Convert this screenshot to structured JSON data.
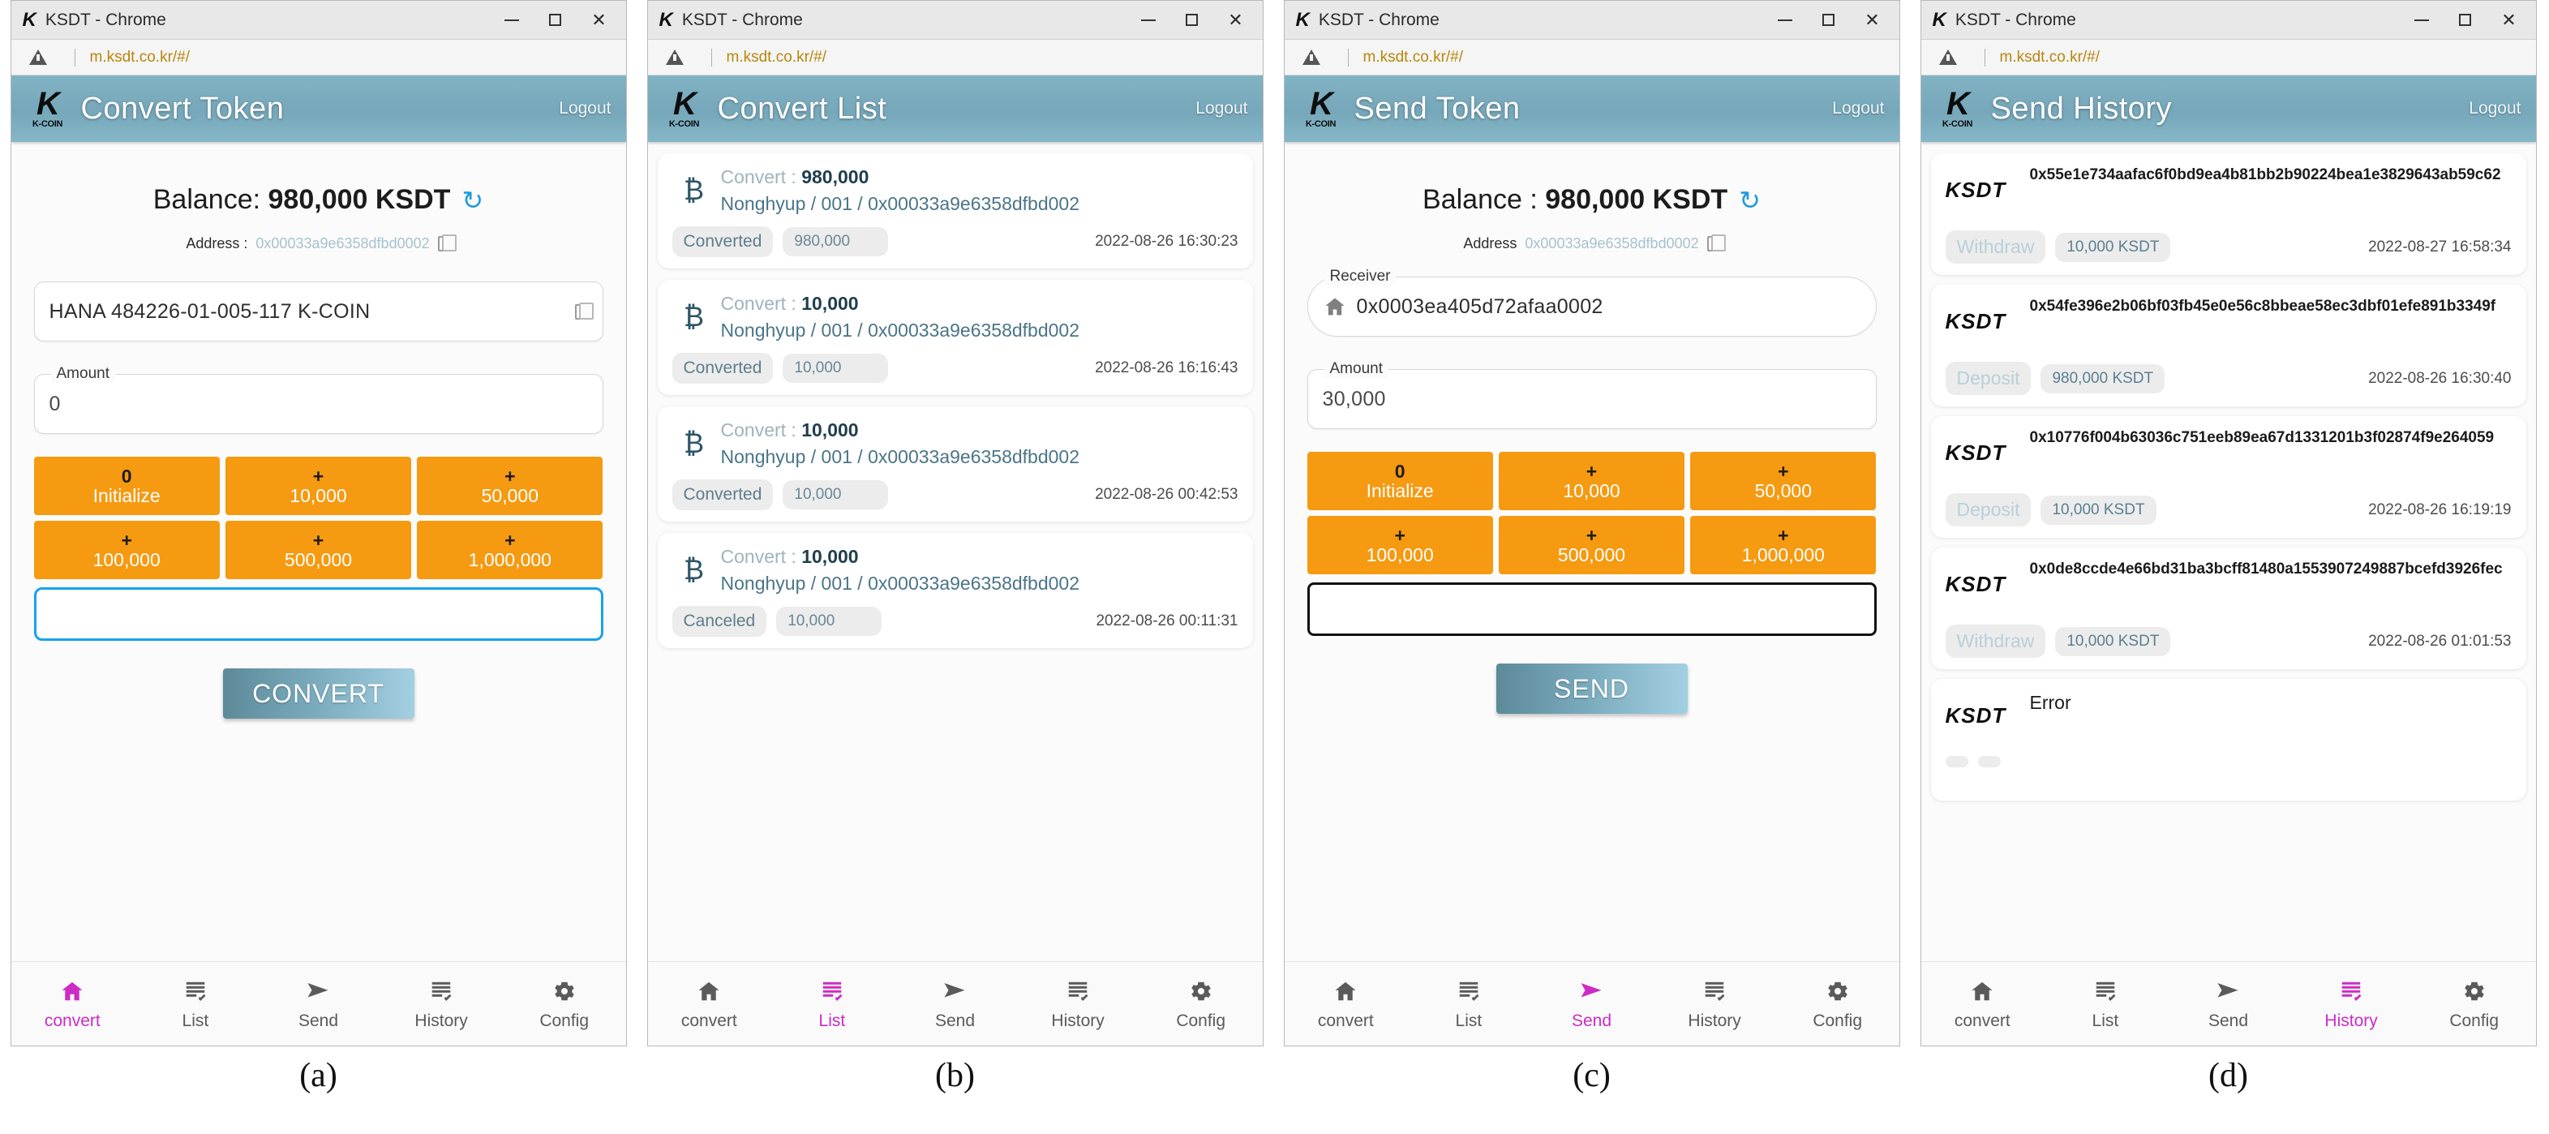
{
  "window": {
    "logo_mark": "K",
    "title": "KSDT  - Chrome",
    "url": "m.ksdt.co.kr/#/",
    "minimize_label": "–",
    "maximize_label": "☐",
    "close_label": "✕",
    "security_icon": "warning-triangle-icon"
  },
  "brand": {
    "logo_mark": "K",
    "logo_sub": "K-COIN",
    "token_logo": "KSDT"
  },
  "nav": {
    "items": [
      {
        "label": "convert",
        "icon": "home-icon"
      },
      {
        "label": "List",
        "icon": "list-check-icon"
      },
      {
        "label": "Send",
        "icon": "send-paper-plane-icon"
      },
      {
        "label": "History",
        "icon": "list-check-icon"
      },
      {
        "label": "Config",
        "icon": "gear-icon"
      }
    ]
  },
  "colors": {
    "header_teal": "#76a7ba",
    "accent_orange": "#f59a11",
    "active_magenta": "#cc2cc6",
    "focus_blue": "#16a2f0",
    "refresh_blue": "#1e9bdf",
    "url_amber": "#b8860b"
  },
  "quick_buttons": [
    {
      "top": "0",
      "bottom": "Initialize"
    },
    {
      "top": "+",
      "bottom": "10,000"
    },
    {
      "top": "+",
      "bottom": "50,000"
    },
    {
      "top": "+",
      "bottom": "100,000"
    },
    {
      "top": "+",
      "bottom": "500,000"
    },
    {
      "top": "+",
      "bottom": "1,000,000"
    }
  ],
  "panel_a": {
    "caption": "(a)",
    "header_title": "Convert Token",
    "logout_label": "Logout",
    "balance_prefix": "Balance: ",
    "balance_value": "980,000 KSDT",
    "refresh_icon": "refresh-icon",
    "address_label": "Address :",
    "address_value": "0x00033a9e6358dfbd0002",
    "copy_icon": "copy-icon",
    "account_value": "HANA 484226-01-005-117 K-COIN",
    "amount_legend": "Amount",
    "amount_value": "0",
    "cta_label": "CONVERT",
    "active_nav": "convert"
  },
  "panel_b": {
    "caption": "(b)",
    "header_title": "Convert List",
    "logout_label": "Logout",
    "active_nav": "List",
    "items": [
      {
        "icon": "bitcoin-icon",
        "label": "Convert : ",
        "amount": "980,000",
        "detail": "Nonghyup / 001 / 0x00033a9e6358dfbd002",
        "status": "Converted",
        "pill_amount": "980,000",
        "timestamp": "2022-08-26 16:30:23"
      },
      {
        "icon": "bitcoin-icon",
        "label": "Convert : ",
        "amount": "10,000",
        "detail": "Nonghyup / 001 / 0x00033a9e6358dfbd002",
        "status": "Converted",
        "pill_amount": "10,000",
        "timestamp": "2022-08-26 16:16:43"
      },
      {
        "icon": "bitcoin-icon",
        "label": "Convert : ",
        "amount": "10,000",
        "detail": "Nonghyup / 001 / 0x00033a9e6358dfbd002",
        "status": "Converted",
        "pill_amount": "10,000",
        "timestamp": "2022-08-26 00:42:53"
      },
      {
        "icon": "bitcoin-icon",
        "label": "Convert : ",
        "amount": "10,000",
        "detail": "Nonghyup / 001 / 0x00033a9e6358dfbd002",
        "status": "Canceled",
        "pill_amount": "10,000",
        "timestamp": "2022-08-26 00:11:31"
      }
    ]
  },
  "panel_c": {
    "caption": "(c)",
    "header_title": "Send Token",
    "logout_label": "Logout",
    "balance_prefix": "Balance : ",
    "balance_value": "980,000 KSDT",
    "refresh_icon": "refresh-icon",
    "address_label": "Address",
    "address_value": "0x00033a9e6358dfbd0002",
    "copy_icon": "copy-icon",
    "receiver_legend": "Receiver",
    "receiver_value": "0x0003ea405d72afaa0002",
    "receiver_icon": "home-icon",
    "amount_legend": "Amount",
    "amount_value": "30,000",
    "cta_label": "SEND",
    "active_nav": "Send"
  },
  "panel_d": {
    "caption": "(d)",
    "header_title": "Send History",
    "logout_label": "Logout",
    "active_nav": "History",
    "items": [
      {
        "logo": "KSDT",
        "hash": "0x55e1e734aafac6f0bd9ea4b81bb2b90224bea1e3829643ab59c62",
        "status": "Withdraw",
        "amount": "10,000 KSDT",
        "timestamp": "2022-08-27 16:58:34"
      },
      {
        "logo": "KSDT",
        "hash": "0x54fe396e2b06bf03fb45e0e56c8bbeae58ec3dbf01efe891b3349f",
        "status": "Deposit",
        "amount": "980,000 KSDT",
        "timestamp": "2022-08-26 16:30:40"
      },
      {
        "logo": "KSDT",
        "hash": "0x10776f004b63036c751eeb89ea67d1331201b3f02874f9e264059",
        "status": "Deposit",
        "amount": "10,000 KSDT",
        "timestamp": "2022-08-26 16:19:19"
      },
      {
        "logo": "KSDT",
        "hash": "0x0de8ccde4e66bd31ba3bcff81480a1553907249887bcefd3926fec",
        "status": "Withdraw",
        "amount": "10,000 KSDT",
        "timestamp": "2022-08-26 01:01:53"
      },
      {
        "logo": "KSDT",
        "hash": "Error",
        "status": "",
        "amount": "",
        "timestamp": ""
      }
    ]
  }
}
